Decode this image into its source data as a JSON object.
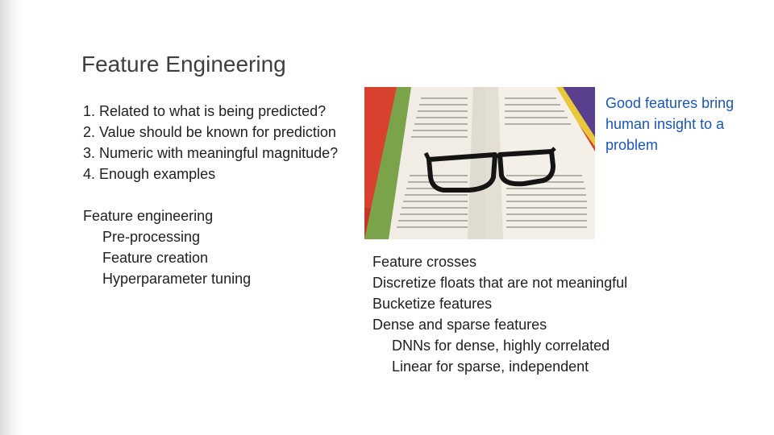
{
  "slide": {
    "title": "Feature Engineering",
    "criteria": [
      "1. Related to what is being predicted?",
      "2. Value should be known for prediction",
      "3. Numeric with meaningful magnitude?",
      "4. Enough examples"
    ],
    "feature_engineering": {
      "heading": "Feature engineering",
      "items": [
        "Pre-processing",
        "Feature creation",
        "Hyperparameter tuning"
      ]
    },
    "techniques": {
      "items": [
        "Feature crosses",
        "Discretize floats that are not meaningful",
        "Bucketize features",
        "Dense and sparse features"
      ],
      "sub_items": [
        "DNNs for dense, highly correlated",
        "Linear for sparse, independent"
      ]
    },
    "callout": "Good features bring human insight to a problem",
    "colors": {
      "title": "#3c4043",
      "body_text": "#202124",
      "callout": "#1a56b8",
      "photo_background": "#d8412e"
    },
    "photo": {
      "icon": "open-book-with-glasses-image"
    }
  }
}
